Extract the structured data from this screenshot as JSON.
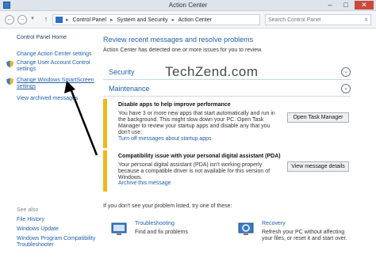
{
  "window": {
    "title": "Action Center"
  },
  "addressbar": {
    "crumbs": [
      "Control Panel",
      "System and Security",
      "Action Center"
    ],
    "search_placeholder": "Search Control Panel"
  },
  "sidebar": {
    "home": "Control Panel Home",
    "links": [
      "Change Action Center settings",
      "Change User Account Control settings",
      "Change Windows SmartScreen settings",
      "View archived messages"
    ],
    "see_also_label": "See also",
    "see_also": [
      "File History",
      "Windows Update",
      "Windows Program Compatibility Troubleshooter"
    ]
  },
  "main": {
    "heading": "Review recent messages and resolve problems",
    "subtext": "Action Center has detected one or more issues for you to review.",
    "sections": [
      "Security",
      "Maintenance"
    ],
    "watermark": "TechZend.com",
    "cards": [
      {
        "title": "Disable apps to help improve performance",
        "body": "You have 3 or more new apps that start automatically and run in the background. This might slow down your PC. Open Task Manager to review your startup apps and disable any that you don't use.",
        "link": "Turn off messages about startup apps",
        "button": "Open Task Manager"
      },
      {
        "title": "Compatibility issue with your personal digital assistant (PDA)",
        "body": "Your personal digital assistant (PDA) isn't working properly because a compatible driver is not available for this version of Windows.",
        "link": "Archive this message",
        "button": "View message details"
      }
    ],
    "footnote": "If you don't see your problem listed, try one of these:",
    "tools": [
      {
        "label": "Troubleshooting",
        "desc": "Find and fix problems"
      },
      {
        "label": "Recovery",
        "desc": "Refresh your PC without affecting your files, or reset it and start over."
      }
    ]
  },
  "colors": {
    "accent": "#1f5fa8",
    "warning": "#f2b61b",
    "close": "#c9493b"
  },
  "icons": [
    "shield-icon",
    "flag-icon",
    "search-icon",
    "chevron-down-icon",
    "troubleshooting-icon",
    "recovery-icon",
    "annotation-arrow"
  ]
}
